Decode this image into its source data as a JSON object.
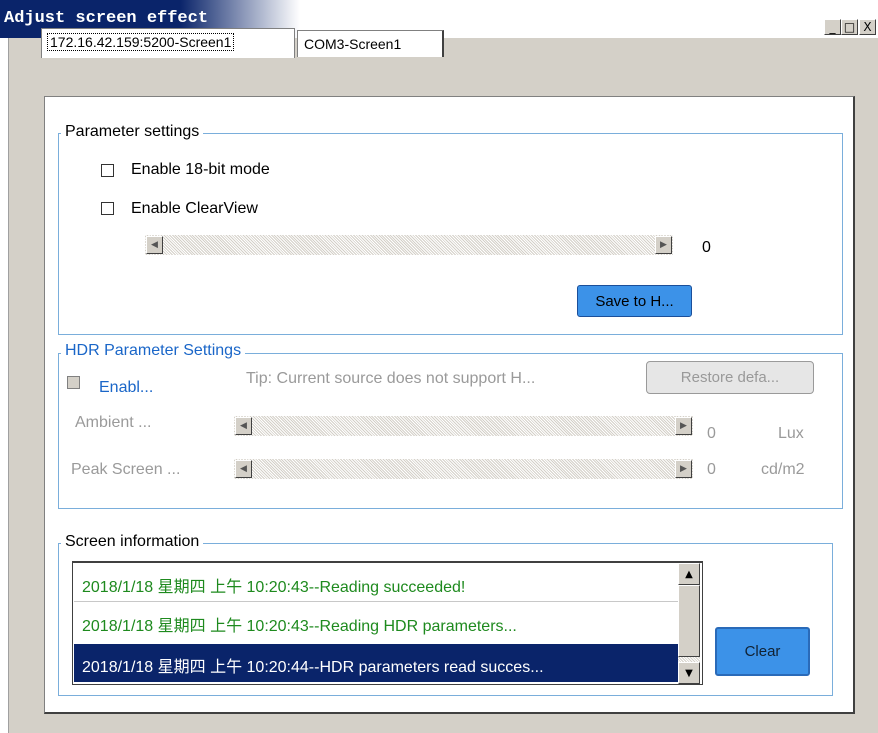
{
  "window": {
    "title": "Adjust screen effect",
    "controls": {
      "minimize": "_",
      "maximize": "□",
      "close": "X"
    }
  },
  "tabs": [
    {
      "label": "172.16.42.159:5200-Screen1",
      "active": true
    },
    {
      "label": "COM3-Screen1",
      "active": false
    }
  ],
  "parameter_settings": {
    "legend": "Parameter settings",
    "enable_18bit_label": "Enable 18-bit mode",
    "enable_18bit_checked": false,
    "enable_clearview_label": "Enable ClearView",
    "enable_clearview_checked": false,
    "clearview_value": "0",
    "save_button": "Save to H..."
  },
  "hdr_settings": {
    "legend": "HDR Parameter Settings",
    "enable_label": "Enabl...",
    "enable_checked": false,
    "tip": "Tip: Current source does not support H...",
    "restore_button": "Restore defa...",
    "ambient_label": "Ambient ...",
    "ambient_value": "0",
    "ambient_unit": "Lux",
    "peak_label": "Peak Screen ...",
    "peak_value": "0",
    "peak_unit": "cd/m2"
  },
  "screen_information": {
    "legend": "Screen information",
    "log": [
      "2018/1/18 星期四 上午 10:20:43--Reading succeeded!",
      "2018/1/18 星期四 上午 10:20:43--Reading HDR parameters...",
      "2018/1/18 星期四 上午 10:20:44--HDR parameters read succes..."
    ],
    "clear_button": "Clear"
  },
  "colors": {
    "accent_button": "#3c92e8",
    "group_border": "#7aaedb",
    "log_text_green": "#1e8a1e",
    "selection_bg": "#0a246a"
  }
}
